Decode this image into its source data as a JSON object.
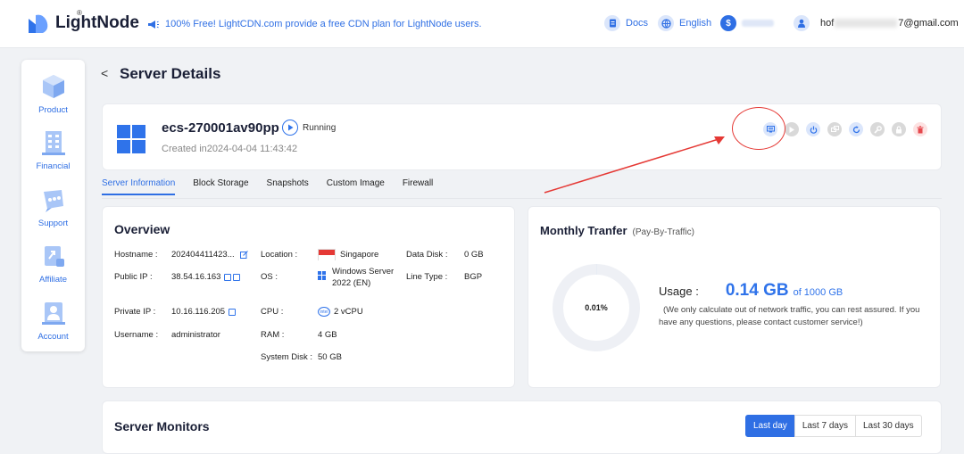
{
  "header": {
    "logo_text": "LightNode",
    "logo_mark": "®",
    "announcement": "100% Free! LightCDN.com provide a free CDN plan for LightNode users.",
    "docs": "Docs",
    "language": "English",
    "user_email_prefix": "hof",
    "user_email_suffix": "7@gmail.com"
  },
  "sidebar": {
    "items": [
      {
        "label": "Product",
        "icon": "cube-icon"
      },
      {
        "label": "Financial",
        "icon": "building-icon"
      },
      {
        "label": "Support",
        "icon": "support-icon"
      },
      {
        "label": "Affiliate",
        "icon": "affiliate-icon"
      },
      {
        "label": "Account",
        "icon": "account-icon"
      }
    ]
  },
  "page": {
    "back": "<",
    "title": "Server Details"
  },
  "server": {
    "name": "ecs-270001av90pp",
    "status": "Running",
    "created": "Created in2024-04-04 11:43:42",
    "actions": [
      "vnc-console-icon",
      "start-icon",
      "power-icon",
      "reinstall-icon",
      "restart-icon",
      "settings-icon",
      "lock-icon",
      "delete-icon"
    ]
  },
  "tabs": [
    "Server Information",
    "Block Storage",
    "Snapshots",
    "Custom Image",
    "Firewall"
  ],
  "overview": {
    "title": "Overview",
    "hostname_k": "Hostname :",
    "hostname_v": "202404411423...",
    "public_ip_k": "Public IP :",
    "public_ip_v": "38.54.16.163",
    "private_ip_k": "Private IP :",
    "private_ip_v": "10.16.116.205",
    "username_k": "Username :",
    "username_v": "administrator",
    "location_k": "Location :",
    "location_v": "Singapore",
    "os_k": "OS :",
    "os_v1": "Windows Server",
    "os_v2": "2022 (EN)",
    "cpu_k": "CPU :",
    "cpu_v": "2 vCPU",
    "ram_k": "RAM :",
    "ram_v": "4 GB",
    "disk_k": "System Disk :",
    "disk_v": "50 GB",
    "data_disk_k": "Data Disk :",
    "data_disk_v": "0 GB",
    "line_type_k": "Line Type :",
    "line_type_v": "BGP"
  },
  "traffic": {
    "title": "Monthly Tranfer",
    "subtitle": "(Pay-By-Traffic)",
    "percent": "0.01%",
    "percent_value": 0.0001,
    "usage_label": "Usage :",
    "usage_value": "0.14 GB",
    "usage_of": "of 1000 GB",
    "note": "(We only calculate out of network traffic, you can rest assured. If you have any questions, please contact customer service!)"
  },
  "monitors": {
    "title": "Server Monitors",
    "ranges": [
      "Last day",
      "Last 7 days",
      "Last 30 days"
    ]
  },
  "colors": {
    "accent": "#2f6fe4",
    "annotation": "#e53935"
  }
}
